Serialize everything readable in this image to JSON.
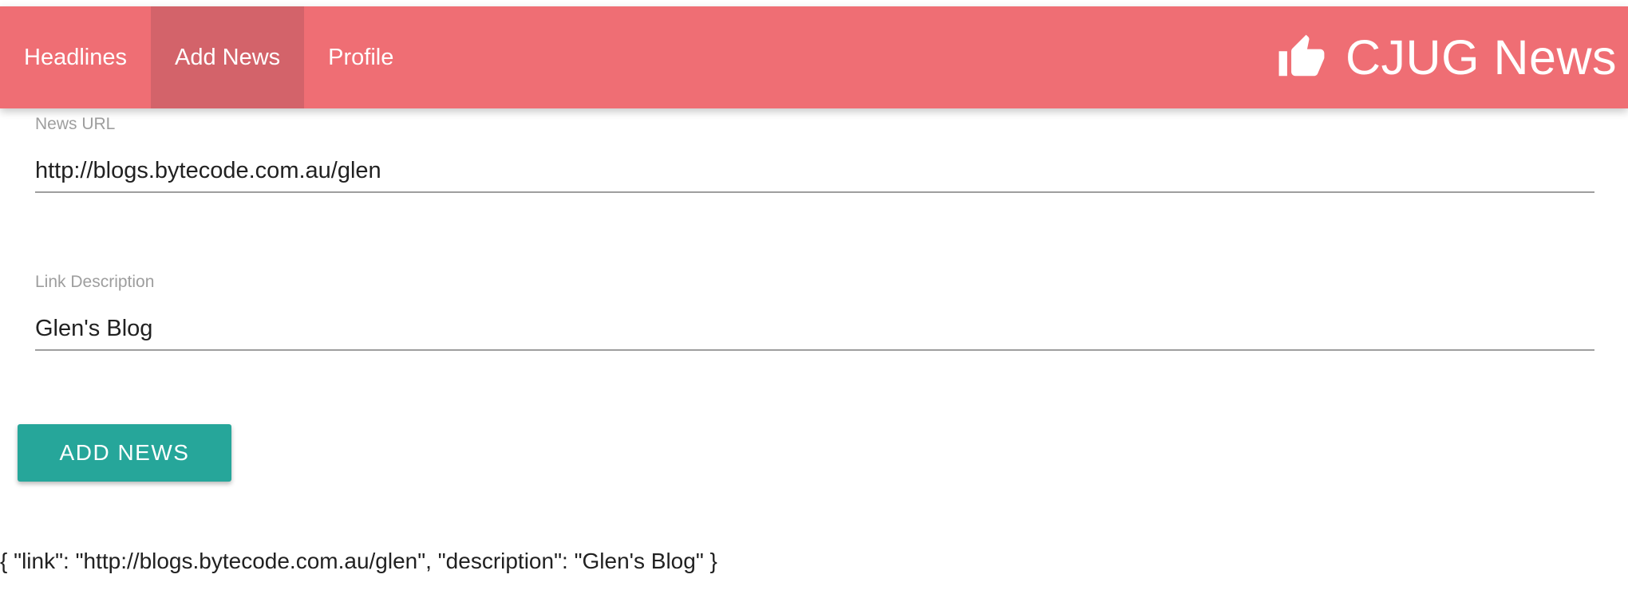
{
  "nav": {
    "tabs": [
      {
        "label": "Headlines"
      },
      {
        "label": "Add News"
      },
      {
        "label": "Profile"
      }
    ],
    "active_tab": "Add News",
    "brand_title": "CJUG News",
    "brand_icon": "thumbs-up-icon"
  },
  "form": {
    "url_label": "News URL",
    "url_value": "http://blogs.bytecode.com.au/glen",
    "description_label": "Link Description",
    "description_value": "Glen's Blog",
    "submit_label": "ADD NEWS"
  },
  "output": {
    "json_text": "{ \"link\": \"http://blogs.bytecode.com.au/glen\", \"description\": \"Glen's Blog\" }"
  },
  "colors": {
    "navbar": "#ef6e74",
    "navbar_active_tab": "#d3636a",
    "button": "#26a69a"
  }
}
